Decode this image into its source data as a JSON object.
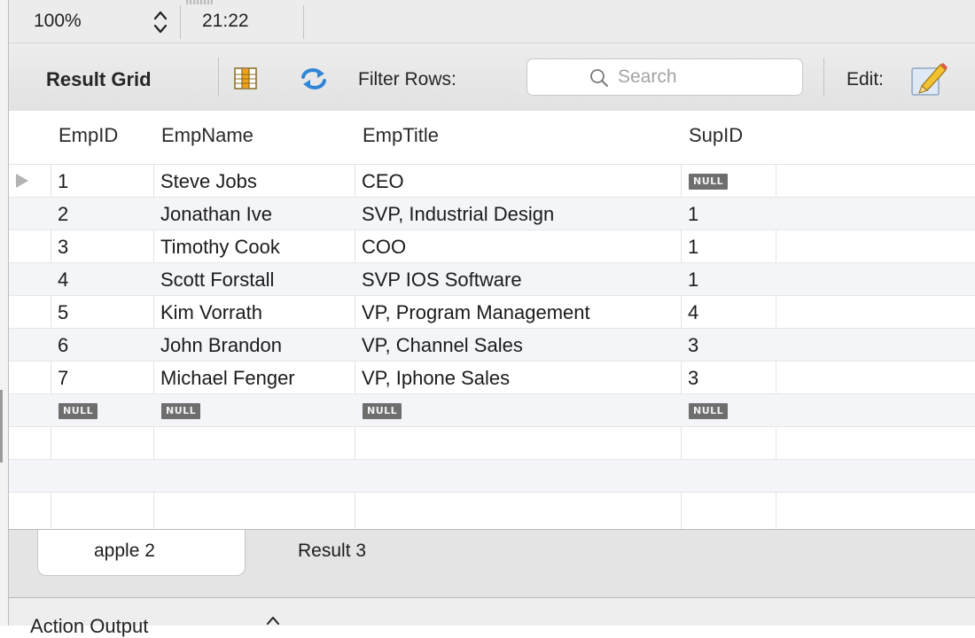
{
  "status_bar": {
    "zoom": "100%",
    "time": "21:22"
  },
  "toolbar": {
    "result_grid_label": "Result Grid",
    "filter_label": "Filter Rows:",
    "search_placeholder": "Search",
    "search_value": "",
    "edit_label": "Edit:"
  },
  "grid": {
    "columns": [
      "EmpID",
      "EmpName",
      "EmpTitle",
      "SupID"
    ],
    "null_label": "NULL",
    "rows": [
      {
        "id": "1",
        "name": "Steve Jobs",
        "title": "CEO",
        "sup": null
      },
      {
        "id": "2",
        "name": "Jonathan Ive",
        "title": "SVP, Industrial Design",
        "sup": "1"
      },
      {
        "id": "3",
        "name": "Timothy Cook",
        "title": "COO",
        "sup": "1"
      },
      {
        "id": "4",
        "name": "Scott Forstall",
        "title": "SVP IOS Software",
        "sup": "1"
      },
      {
        "id": "5",
        "name": "Kim Vorrath",
        "title": "VP, Program Management",
        "sup": "4"
      },
      {
        "id": "6",
        "name": "John Brandon",
        "title": "VP, Channel Sales",
        "sup": "3"
      },
      {
        "id": "7",
        "name": "Michael Fenger",
        "title": "VP, Iphone Sales",
        "sup": "3"
      }
    ]
  },
  "tabs": [
    {
      "label": "apple 2",
      "active": true
    },
    {
      "label": "Result 3",
      "active": false
    }
  ],
  "action_output": {
    "label": "Action Output"
  },
  "icons": {
    "stepper": "stepper-icon",
    "grid": "column-grid-icon",
    "refresh": "refresh-icon",
    "search": "magnifier-icon",
    "edit": "pencil-edit-icon",
    "row_marker": "current-row-arrow-icon",
    "chevron": "chevron-up-icon"
  },
  "colors": {
    "null_badge": "#6e6e6e",
    "refresh_blue": "#2f86d6",
    "grid_icon_orange": "#f0a21c"
  }
}
